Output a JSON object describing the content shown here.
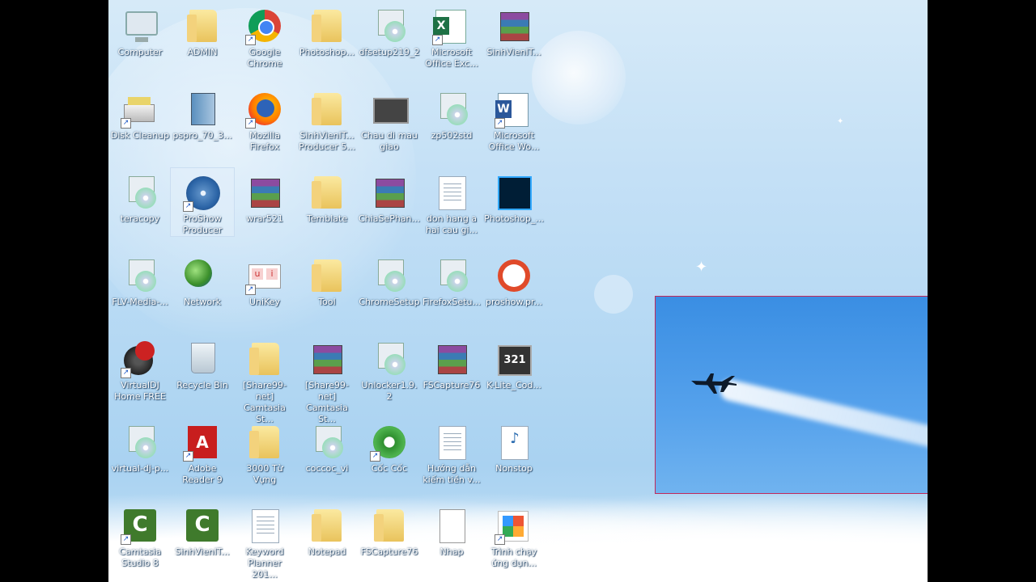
{
  "desktop": {
    "icons": [
      {
        "label": "Computer",
        "icon": "computer-icon",
        "shortcut": false
      },
      {
        "label": "ADMIN",
        "icon": "user-folder-icon",
        "shortcut": false
      },
      {
        "label": "Google Chrome",
        "icon": "chrome-icon",
        "shortcut": true
      },
      {
        "label": "Photoshop...",
        "icon": "folder-icon",
        "shortcut": false
      },
      {
        "label": "dfsetup219_2",
        "icon": "setup-icon",
        "shortcut": false
      },
      {
        "label": "Microsoft Office Exc...",
        "icon": "excel-icon",
        "shortcut": true
      },
      {
        "label": "SinhVienIT...",
        "icon": "winrar-icon",
        "shortcut": false
      },
      {
        "label": "Disk Cleanup",
        "icon": "disk-cleanup-icon",
        "shortcut": true
      },
      {
        "label": "pspro_70_3...",
        "icon": "pspro-icon",
        "shortcut": false
      },
      {
        "label": "Mozilla Firefox",
        "icon": "firefox-icon",
        "shortcut": true
      },
      {
        "label": "SinhVienIT... Producer 5...",
        "icon": "folder-icon",
        "shortcut": false
      },
      {
        "label": "Chau di mau giao",
        "icon": "video-icon",
        "shortcut": false
      },
      {
        "label": "zp502std",
        "icon": "setup-icon",
        "shortcut": false
      },
      {
        "label": "Microsoft Office Wo...",
        "icon": "word-icon",
        "shortcut": true
      },
      {
        "label": "teracopy",
        "icon": "setup-icon",
        "shortcut": false
      },
      {
        "label": "ProShow Producer",
        "icon": "proshow-icon",
        "shortcut": true,
        "selected": true
      },
      {
        "label": "wrar521",
        "icon": "winrar-icon",
        "shortcut": false
      },
      {
        "label": "Temblate",
        "icon": "folder-icon",
        "shortcut": false
      },
      {
        "label": "ChiaSePhan...",
        "icon": "winrar-icon",
        "shortcut": false
      },
      {
        "label": "don hang a hai cau gi...",
        "icon": "excel-doc-icon",
        "shortcut": false
      },
      {
        "label": "Photoshop_...",
        "icon": "photoshop-icon",
        "shortcut": false
      },
      {
        "label": "FLV-Media-...",
        "icon": "setup-icon",
        "shortcut": false
      },
      {
        "label": "Network",
        "icon": "network-icon",
        "shortcut": false
      },
      {
        "label": "UniKey",
        "icon": "unikey-icon",
        "shortcut": true
      },
      {
        "label": "Tool",
        "icon": "folder-icon",
        "shortcut": false
      },
      {
        "label": "ChromeSetup",
        "icon": "setup-icon",
        "shortcut": false
      },
      {
        "label": "FirefoxSetu...",
        "icon": "setup-icon",
        "shortcut": false
      },
      {
        "label": "proshow.pr...",
        "icon": "no-entry-icon",
        "shortcut": false
      },
      {
        "label": "VirtualDJ Home FREE",
        "icon": "virtualdj-icon",
        "shortcut": true
      },
      {
        "label": "Recycle Bin",
        "icon": "recycle-bin-icon",
        "shortcut": false
      },
      {
        "label": "[Share99-net] Camtasia St...",
        "icon": "folder-icon",
        "shortcut": false
      },
      {
        "label": "[Share99-net] Camtasia St...",
        "icon": "winrar-icon",
        "shortcut": false
      },
      {
        "label": "Unlocker1.9.2",
        "icon": "setup-icon",
        "shortcut": false
      },
      {
        "label": "FSCapture76",
        "icon": "winrar-icon",
        "shortcut": false
      },
      {
        "label": "K-Lite_Cod...",
        "icon": "klite-icon",
        "shortcut": false
      },
      {
        "label": "virtual-dj-p...",
        "icon": "setup-icon",
        "shortcut": false
      },
      {
        "label": "Adobe Reader 9",
        "icon": "adobe-reader-icon",
        "shortcut": true
      },
      {
        "label": "3000 Từ Vựng",
        "icon": "folder-icon",
        "shortcut": false
      },
      {
        "label": "coccoc_vi",
        "icon": "setup-icon",
        "shortcut": false
      },
      {
        "label": "Cốc Cốc",
        "icon": "coccoc-icon",
        "shortcut": true
      },
      {
        "label": "Hướng dẫn kiếm tiền v...",
        "icon": "word-doc-icon",
        "shortcut": false
      },
      {
        "label": "Nonstop",
        "icon": "mp3-icon",
        "shortcut": false
      },
      {
        "label": "Camtasia Studio 8",
        "icon": "camtasia-icon",
        "shortcut": true
      },
      {
        "label": "SinhVienIT...",
        "icon": "camtasia-icon",
        "shortcut": false
      },
      {
        "label": "Keyword Planner 201...",
        "icon": "excel-doc-icon",
        "shortcut": false
      },
      {
        "label": "Notepad",
        "icon": "folder-icon",
        "shortcut": false
      },
      {
        "label": "FSCapture76",
        "icon": "folder-icon",
        "shortcut": false
      },
      {
        "label": "Nhap",
        "icon": "text-file-icon",
        "shortcut": false
      },
      {
        "label": "Trình chạy ứng dụn...",
        "icon": "apps-icon",
        "shortcut": true
      }
    ]
  },
  "colors": {
    "photo_border": "#c0295a",
    "sky": "#56a2ec"
  }
}
